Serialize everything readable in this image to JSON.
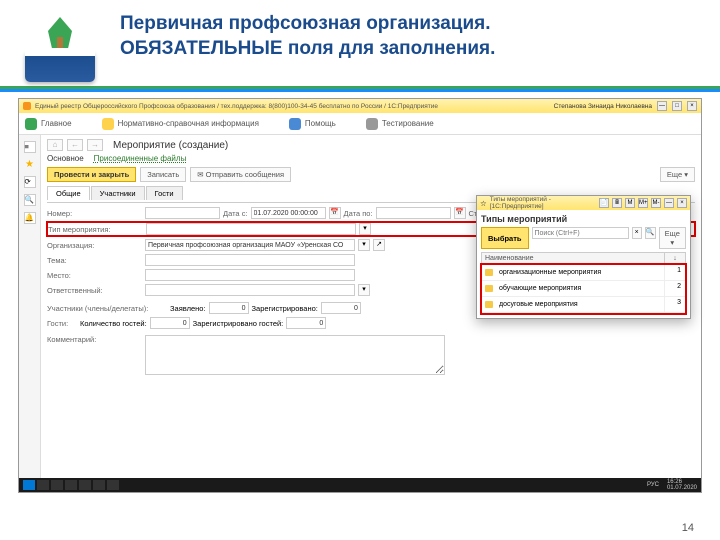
{
  "slide": {
    "title_line1": "Первичная профсоюзная организация.",
    "title_line2": "ОБЯЗАТЕЛЬНЫЕ поля для заполнения.",
    "page_number": "14"
  },
  "app": {
    "title": "Единый реестр Общероссийского Профсоюза образования / тех.поддержка: 8(800)100-34-45 бесплатно по России / 1С:Предприятие",
    "user": "Степанова Зинаида Николаевна",
    "nav": {
      "main": "Главное",
      "ref": "Нормативно-справочная информация",
      "help": "Помощь",
      "test": "Тестирование"
    }
  },
  "form": {
    "breadcrumb_title": "Мероприятие (создание)",
    "tabs": {
      "main": "Основное",
      "files": "Присоединенные файлы"
    },
    "buttons": {
      "save_close": "Провести и закрыть",
      "write": "Записать",
      "send": "✉ Отправить сообщения",
      "more": "Еще ▾"
    },
    "section_tabs": {
      "general": "Общие",
      "participants": "Участники",
      "guests": "Гости"
    },
    "labels": {
      "number": "Номер:",
      "date_from": "Дата с:",
      "date_to": "Дата по:",
      "status": "Статус мероприятия:",
      "type": "Тип мероприятия:",
      "org": "Организация:",
      "theme": "Тема:",
      "place": "Место:",
      "responsible": "Ответственный:",
      "participants": "Участники (члены/делегаты):",
      "declared": "Заявлено:",
      "registered": "Зарегистрировано:",
      "guests": "Гости:",
      "guest_count": "Количество гостей:",
      "guest_registered": "Зарегистрировано гостей:",
      "comment": "Комментарий:"
    },
    "values": {
      "date_from": "01.07.2020 00:00:00",
      "org": "Первичная профсоюзная организация МАОУ «Уренская СО",
      "declared": "0",
      "registered": "0",
      "guest_count": "0",
      "guest_registered": "0"
    }
  },
  "popup": {
    "title": "Типы мероприятий - [1С:Предприятие]",
    "heading": "Типы мероприятий",
    "select": "Выбрать",
    "search_placeholder": "Поиск (Ctrl+F)",
    "more": "Еще ▾",
    "col_name": "Наименование",
    "col_idx": "↓",
    "rows": [
      {
        "name": "организационные мероприятия",
        "idx": "1"
      },
      {
        "name": "обучающие мероприятия",
        "idx": "2"
      },
      {
        "name": "досуговые мероприятия",
        "idx": "3"
      }
    ]
  },
  "taskbar": {
    "time": "16:26",
    "date": "01.07.2020",
    "lang": "РУС"
  }
}
